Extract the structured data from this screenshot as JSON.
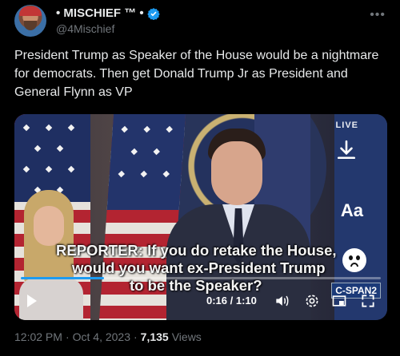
{
  "author": {
    "display_name": "• MISCHIEF ™ •",
    "handle": "@4Mischief",
    "verified": true
  },
  "tweet": {
    "text": "President Trump as Speaker of the House would be a nightmare for democrats. Then get Donald Trump Jr as President and General Flynn as VP"
  },
  "video": {
    "live_label": "LIVE",
    "caption_line1": "REPORTER: If you do retake the House,",
    "caption_line2": "would you want ex-President Trump",
    "caption_line3": "to be the Speaker?",
    "network_badge": "C-SPAN2",
    "subtitle_button": "Aa",
    "time_display": "0:16 / 1:10",
    "progress_fraction": 0.23
  },
  "meta": {
    "time": "12:02 PM",
    "separator": "·",
    "date": "Oct 4, 2023",
    "separator2": "·",
    "views_count": "7,135",
    "views_label": "Views"
  },
  "colors": {
    "accent": "#1d9bf0",
    "muted": "#71767b",
    "text": "#e7e9ea"
  }
}
